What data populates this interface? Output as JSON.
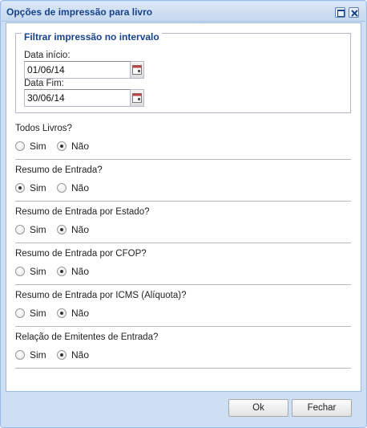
{
  "window": {
    "title": "Opções de impressão para livro"
  },
  "filter": {
    "legend": "Filtrar impressão no intervalo",
    "start_label": "Data início:",
    "start_value": "01/06/14",
    "end_label": "Data Fim:",
    "end_value": "30/06/14"
  },
  "options": {
    "yes_label": "Sim",
    "no_label": "Não",
    "questions": [
      {
        "label": "Todos Livros?",
        "selected": "Não"
      },
      {
        "label": "Resumo de Entrada?",
        "selected": "Sim"
      },
      {
        "label": "Resumo de Entrada por Estado?",
        "selected": "Não"
      },
      {
        "label": "Resumo de Entrada por CFOP?",
        "selected": "Não"
      },
      {
        "label": "Resumo de Entrada por ICMS (Alíquota)?",
        "selected": "Não"
      },
      {
        "label": "Relação de Emitentes de Entrada?",
        "selected": "Não"
      }
    ]
  },
  "buttons": {
    "ok": "Ok",
    "close": "Fechar"
  },
  "colors": {
    "title_text": "#15428b",
    "window_frame": "#99bbe8",
    "frame_bg": "#cfdff3"
  }
}
